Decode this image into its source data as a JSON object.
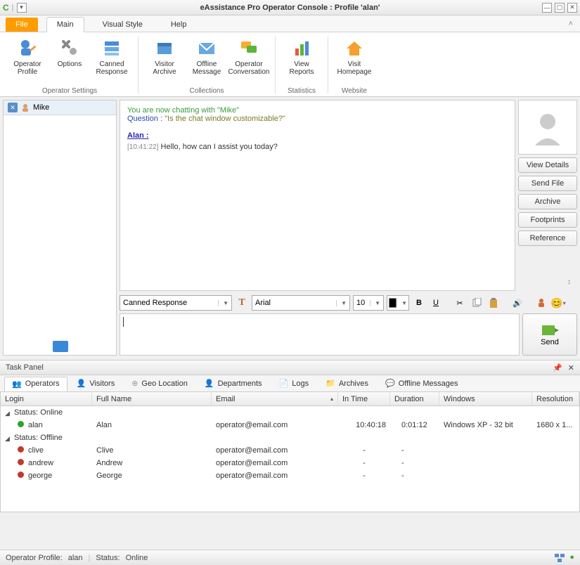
{
  "window": {
    "title": "eAssistance Pro Operator Console : Profile 'alan'"
  },
  "menu": {
    "file": "File",
    "main": "Main",
    "visual": "Visual Style",
    "help": "Help"
  },
  "ribbon": {
    "operator_profile": "Operator\nProfile",
    "options": "Options",
    "canned_response": "Canned\nResponse",
    "visitor_archive": "Visitor\nArchive",
    "offline_message": "Offline\nMessage",
    "operator_conversation": "Operator\nConversation",
    "view_reports": "View\nReports",
    "visit_homepage": "Visit\nHomepage",
    "grp_settings": "Operator Settings",
    "grp_collections": "Collections",
    "grp_statistics": "Statistics",
    "grp_website": "Website"
  },
  "chatlist": {
    "items": [
      {
        "name": "Mike"
      }
    ]
  },
  "chat": {
    "sys1_a": "You are now chatting with \"",
    "sys1_name": "Mike",
    "sys1_b": "\"",
    "sys2_label": "Question",
    "sys2_sep": " : ",
    "sys2_q": "\"Is the chat window customizable?\"",
    "who": "Alan :",
    "ts": "[10:41:22]",
    "msg": "Hello, how can I assist you today?"
  },
  "side": {
    "view_details": "View Details",
    "send_file": "Send File",
    "archive": "Archive",
    "footprints": "Footprints",
    "reference": "Reference"
  },
  "toolbar": {
    "canned": "Canned Response",
    "font": "Arial",
    "size": "10",
    "bold": "B",
    "underline": "U"
  },
  "send": "Send",
  "taskpanel": {
    "title": "Task Panel",
    "tabs": {
      "operators": "Operators",
      "visitors": "Visitors",
      "geo": "Geo Location",
      "departments": "Departments",
      "logs": "Logs",
      "archives": "Archives",
      "offline": "Offline Messages"
    },
    "cols": {
      "login": "Login",
      "fullname": "Full Name",
      "email": "Email",
      "intime": "In Time",
      "duration": "Duration",
      "windows": "Windows",
      "resolution": "Resolution"
    },
    "group_online": "Status:  Online",
    "group_offline": "Status:  Offline",
    "rows_online": [
      {
        "login": "alan",
        "name": "Alan",
        "email": "operator@email.com",
        "intime": "10:40:18",
        "dur": "0:01:12",
        "win": "Windows XP - 32 bit",
        "res": "1680 x 1..."
      }
    ],
    "rows_offline": [
      {
        "login": "clive",
        "name": "Clive",
        "email": "operator@email.com",
        "intime": "-",
        "dur": "-",
        "win": "",
        "res": ""
      },
      {
        "login": "andrew",
        "name": "Andrew",
        "email": "operator@email.com",
        "intime": "-",
        "dur": "-",
        "win": "",
        "res": ""
      },
      {
        "login": "george",
        "name": "George",
        "email": "operator@email.com",
        "intime": "-",
        "dur": "-",
        "win": "",
        "res": ""
      }
    ]
  },
  "status": {
    "profile_label": "Operator Profile:",
    "profile_value": "alan",
    "status_label": "Status:",
    "status_value": "Online"
  }
}
